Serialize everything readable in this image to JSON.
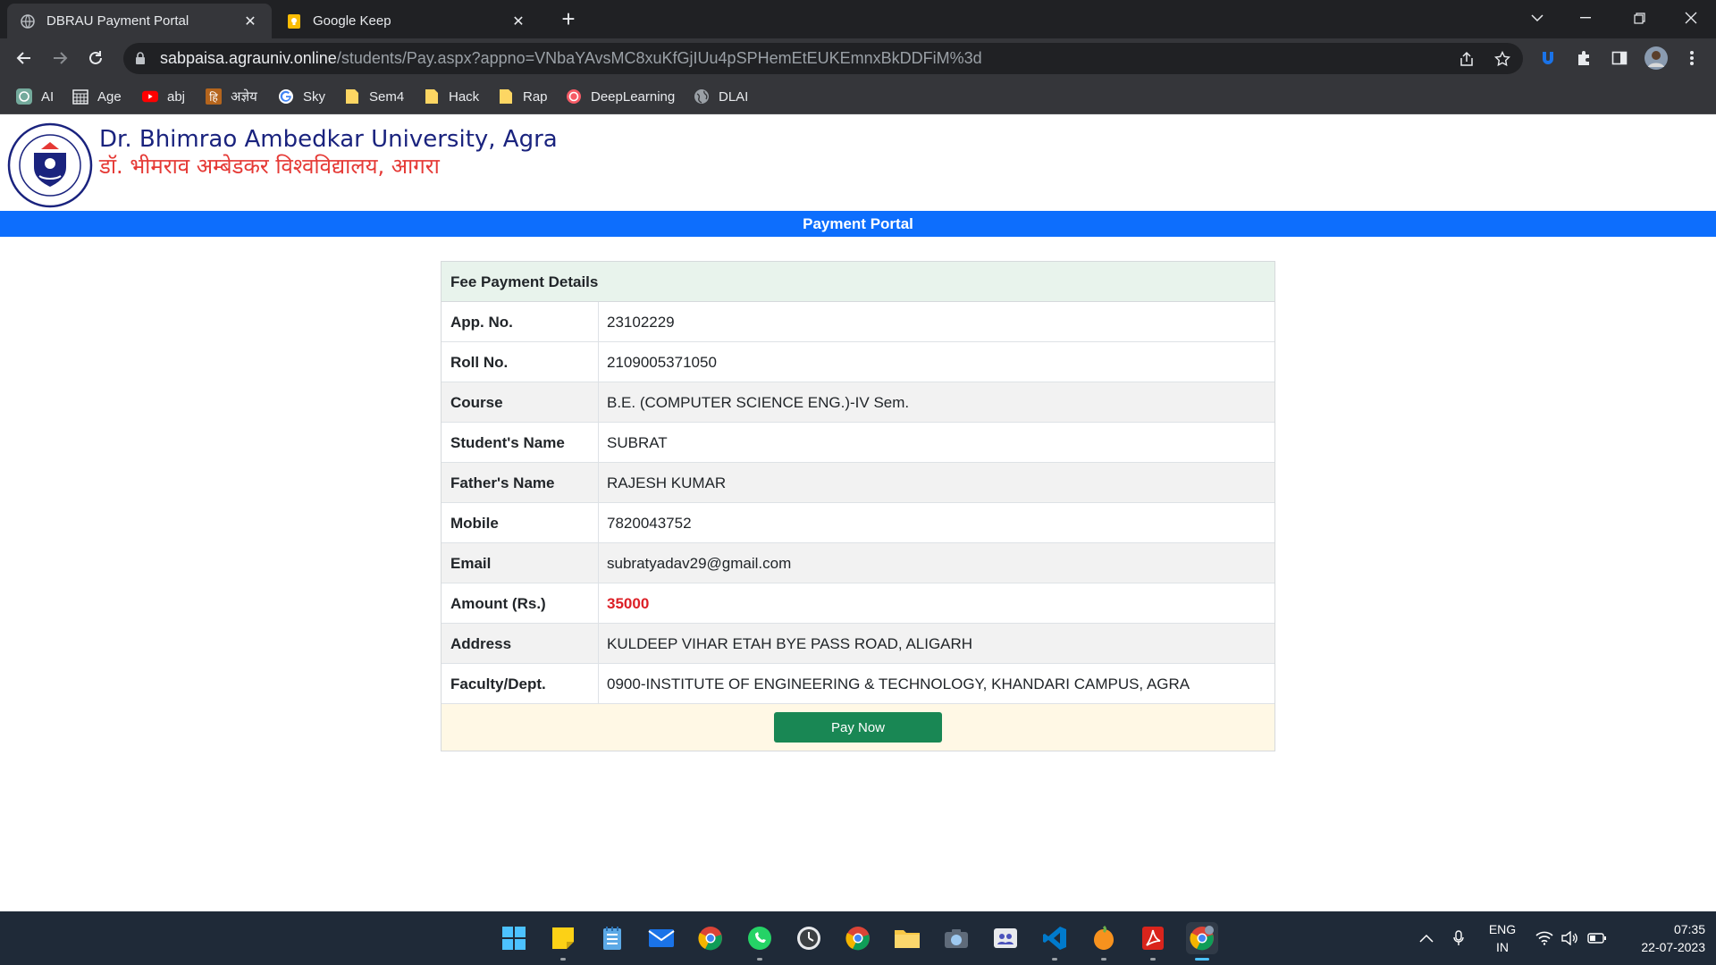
{
  "browser": {
    "tabs": [
      {
        "title": "DBRAU Payment Portal",
        "active": true
      },
      {
        "title": "Google Keep",
        "active": false
      }
    ],
    "url": {
      "host": "sabpaisa.agrauniv.online",
      "path": "/students/Pay.aspx?appno=VNbaYAvsMC8xuKfGjIUu4pSPHemEtEUKEmnxBkDDFiM%3d"
    },
    "bookmarks": [
      {
        "label": "AI",
        "icon": "openai-icon"
      },
      {
        "label": "Age",
        "icon": "calendar-icon"
      },
      {
        "label": "abj",
        "icon": "youtube-icon"
      },
      {
        "label": "अज्ञेय",
        "icon": "hindi-icon"
      },
      {
        "label": "Sky",
        "icon": "google-icon"
      },
      {
        "label": "Sem4",
        "icon": "folder-icon"
      },
      {
        "label": "Hack",
        "icon": "folder-icon"
      },
      {
        "label": "Rap",
        "icon": "folder-icon"
      },
      {
        "label": "DeepLearning",
        "icon": "deeplearning-icon"
      },
      {
        "label": "DLAI",
        "icon": "globe-icon"
      }
    ]
  },
  "header": {
    "university_en": "Dr. Bhimrao Ambedkar University, Agra",
    "university_hi": "डॉ. भीमराव अम्बेडकर विश्वविद्यालय, आगरा",
    "portal_title": "Payment Portal"
  },
  "fee": {
    "heading": "Fee Payment Details",
    "rows": [
      {
        "label": "App. No.",
        "value": "23102229"
      },
      {
        "label": "Roll No.",
        "value": "2109005371050"
      },
      {
        "label": "Course",
        "value": "B.E. (COMPUTER SCIENCE ENG.)-IV Sem."
      },
      {
        "label": "Student's Name",
        "value": "SUBRAT"
      },
      {
        "label": "Father's Name",
        "value": "RAJESH KUMAR"
      },
      {
        "label": "Mobile",
        "value": "7820043752"
      },
      {
        "label": "Email",
        "value": "subratyadav29@gmail.com"
      },
      {
        "label": "Amount (Rs.)",
        "value": "35000"
      },
      {
        "label": "Address",
        "value": "KULDEEP VIHAR ETAH BYE PASS ROAD, ALIGARH"
      },
      {
        "label": "Faculty/Dept.",
        "value": "0900-INSTITUTE OF ENGINEERING & TECHNOLOGY, KHANDARI CAMPUS, AGRA"
      }
    ],
    "pay_button": "Pay Now"
  },
  "taskbar": {
    "language_line1": "ENG",
    "language_line2": "IN",
    "time": "07:35",
    "date": "22-07-2023"
  },
  "colors": {
    "portal_bar": "#0d6efd",
    "pay_button": "#198754",
    "amount": "#dc1f26",
    "university_en": "#1a237e",
    "university_hi": "#e53935"
  }
}
